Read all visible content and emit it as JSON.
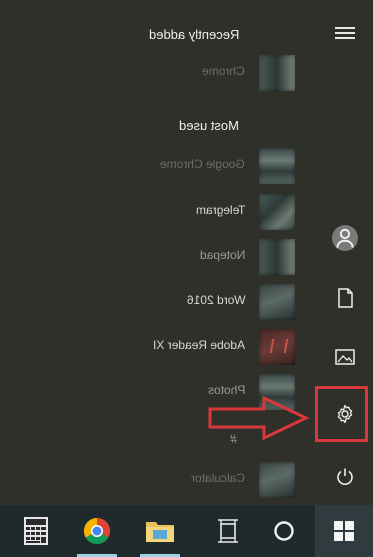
{
  "start_menu": {
    "recently_added_label": "Recently added",
    "most_used_label": "Most used",
    "recent_items": [
      {
        "label": "Chrome"
      }
    ],
    "most_used_items": [
      {
        "label": "Google Chrome"
      },
      {
        "label": "Telegram"
      },
      {
        "label": "Notepad"
      },
      {
        "label": "Word 2016"
      },
      {
        "label": "Adobe Reader XI"
      },
      {
        "label": "Photos"
      }
    ],
    "section_letter": "#",
    "bottom_item": {
      "label": "Calculator"
    }
  },
  "rail": {
    "icons": [
      "hamburger-icon",
      "user-icon",
      "document-icon",
      "pictures-icon",
      "settings-icon",
      "power-icon"
    ]
  },
  "taskbar": {
    "icons": [
      "calculator-icon",
      "chrome-icon",
      "file-explorer-icon",
      "task-view-icon",
      "cortana-icon",
      "windows-start-icon"
    ]
  },
  "annotation": {
    "color": "#d9383a"
  }
}
